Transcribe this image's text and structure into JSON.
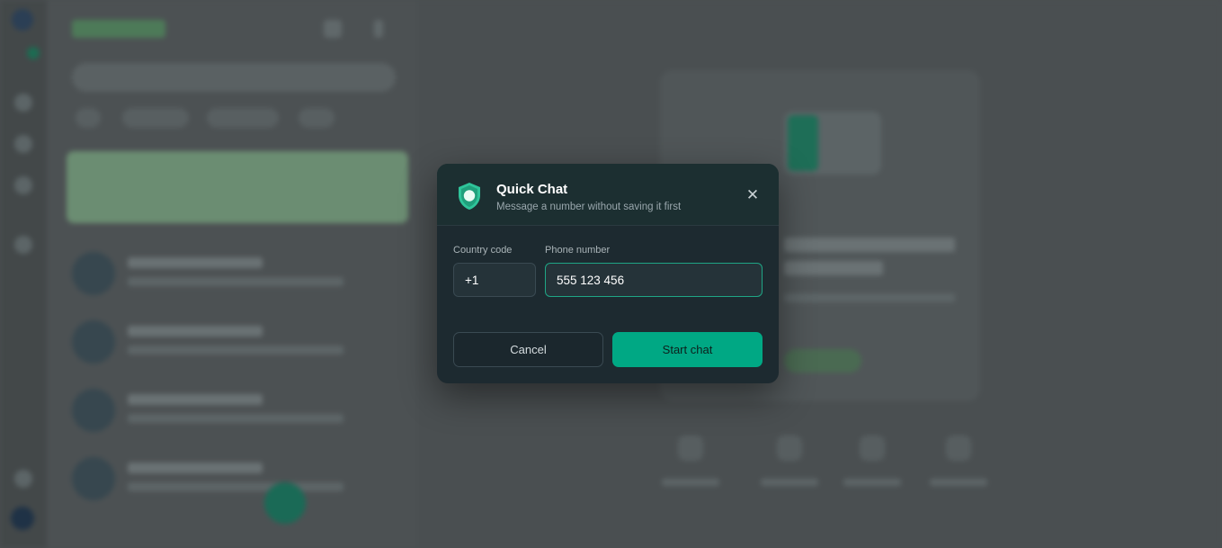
{
  "dialog": {
    "title": "Quick Chat",
    "subtitle": "Message a number without saving it first",
    "close_icon": "close-icon",
    "header_icon": "shield-chat-icon",
    "country_code": {
      "label": "Country code",
      "value": "+1"
    },
    "phone_number": {
      "label": "Phone number",
      "value": "555 123 456"
    },
    "cancel_label": "Cancel",
    "start_label": "Start chat"
  },
  "colors": {
    "accent": "#00a884",
    "dialog_bg": "#1d2a30",
    "overlay_bg": "#4a4f51"
  }
}
